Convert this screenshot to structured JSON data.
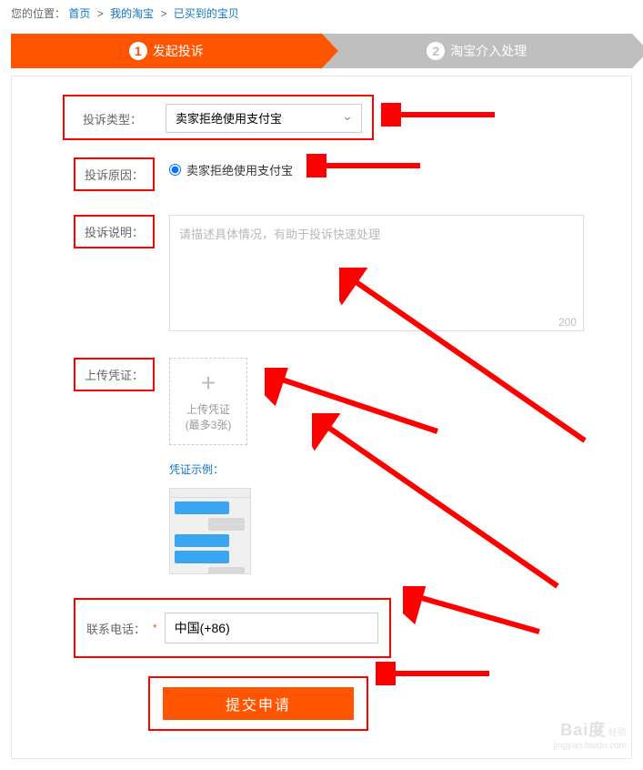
{
  "breadcrumb": {
    "prefix": "您的位置：",
    "links": [
      "首页",
      "我的淘宝",
      "已买到的宝贝"
    ]
  },
  "steps": {
    "s1": {
      "num": "1",
      "label": "发起投诉"
    },
    "s2": {
      "num": "2",
      "label": "淘宝介入处理"
    }
  },
  "form": {
    "type": {
      "label": "投诉类型：",
      "value": "卖家拒绝使用支付宝"
    },
    "reason": {
      "label": "投诉原因：",
      "option": "卖家拒绝使用支付宝"
    },
    "desc": {
      "label": "投诉说明：",
      "placeholder": "请描述具体情况，有助于投诉快速处理",
      "count": "200"
    },
    "upload": {
      "label": "上传凭证：",
      "btn": "上传凭证",
      "hint": "(最多3张)",
      "example": "凭证示例："
    },
    "phone": {
      "label": "联系电话：",
      "value": "中国(+86)"
    },
    "submit": "提交申请"
  },
  "watermark": {
    "brand": "Bai",
    "brand2": "度",
    "sub": "经验",
    "url": "jingyan.baidu.com"
  }
}
